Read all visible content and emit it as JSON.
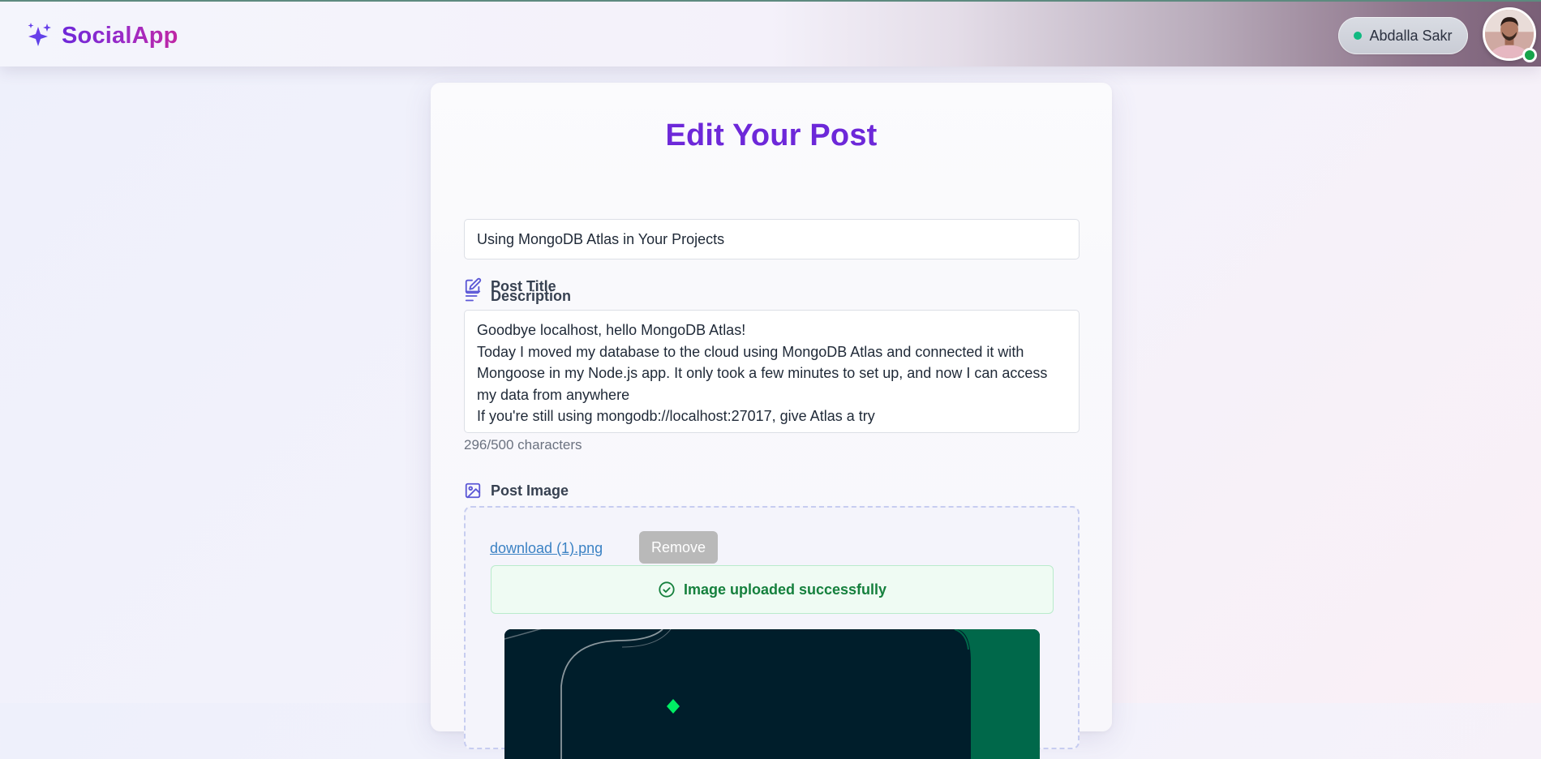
{
  "header": {
    "brand_name": "SocialApp",
    "brand_icon": "sparkles-icon",
    "user_name": "Abdalla Sakr",
    "user_status_color": "#10b981",
    "avatar_icon": "user-avatar"
  },
  "form": {
    "heading": "Edit Your Post",
    "title_label": "Post Title",
    "title_icon": "edit-icon",
    "title_value": "Using MongoDB Atlas in Your Projects",
    "description_label": "Description",
    "description_icon": "align-left-icon",
    "description_value": "Goodbye localhost, hello MongoDB Atlas!\nToday I moved my database to the cloud using MongoDB Atlas and connected it with Mongoose in my Node.js app. It only took a few minutes to set up, and now I can access my data from anywhere\nIf you're still using mongodb://localhost:27017, give Atlas a try",
    "char_count": "296/500 characters",
    "image_label": "Post Image",
    "image_icon": "image-icon",
    "file_name": "download (1).png",
    "remove_label": "Remove",
    "success_message": "Image uploaded successfully",
    "success_icon": "check-circle-icon"
  },
  "colors": {
    "accent": "#6d28d9",
    "brand_end": "#c026a3",
    "success": "#15803d",
    "link": "#3b82c4"
  }
}
